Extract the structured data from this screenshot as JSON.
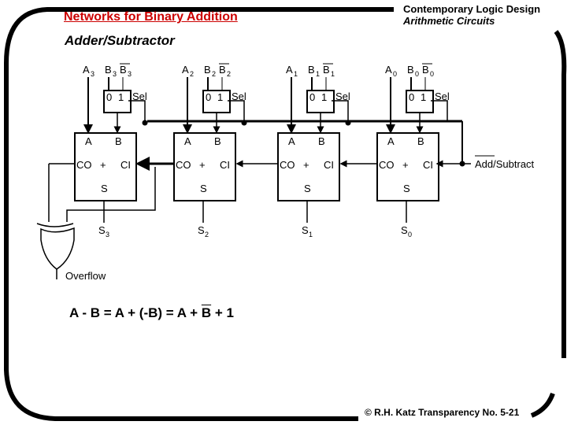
{
  "header": {
    "title": "Networks for Binary Addition",
    "course": "Contemporary Logic Design",
    "chapter": "Arithmetic Circuits",
    "subtitle": "Adder/Subtractor"
  },
  "diagram": {
    "stages": [
      {
        "a": "A",
        "a_sub": "3",
        "b": "B",
        "b_sub": "3",
        "s_out": "S",
        "s_sub": "3"
      },
      {
        "a": "A",
        "a_sub": "2",
        "b": "B",
        "b_sub": "2",
        "s_out": "S",
        "s_sub": "2"
      },
      {
        "a": "A",
        "a_sub": "1",
        "b": "B",
        "b_sub": "1",
        "s_out": "S",
        "s_sub": "1"
      },
      {
        "a": "A",
        "a_sub": "0",
        "b": "B",
        "b_sub": "0",
        "s_out": "S",
        "s_sub": "0"
      }
    ],
    "mux": {
      "in0": "0",
      "in1": "1",
      "sel": "Sel"
    },
    "adder": {
      "a": "A",
      "b": "B",
      "co": "CO",
      "op": "+",
      "ci": "CI",
      "s": "S"
    },
    "control_label": "Add/Subtract",
    "overflow_label": "Overflow"
  },
  "equation": {
    "part1": "A - B = A + (-B) = A + ",
    "bbar": "B",
    "part2": " + 1"
  },
  "footer": {
    "text": "© R.H. Katz   Transparency No. 5-21"
  }
}
